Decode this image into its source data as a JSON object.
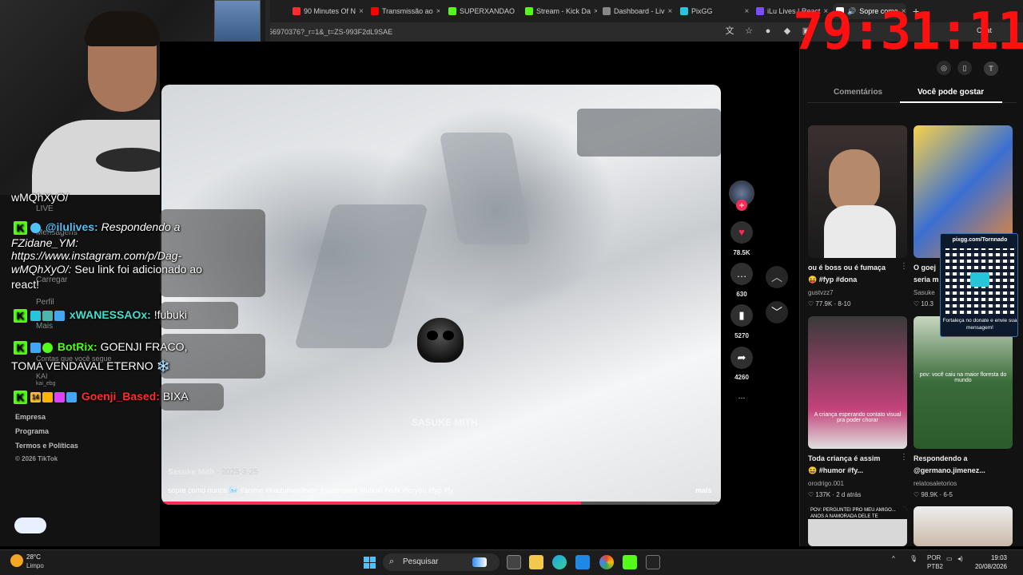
{
  "browser": {
    "tabs": [
      {
        "label": "90 Minutes Of N",
        "color": "#ff2d2d"
      },
      {
        "label": "Transmissão ao",
        "color": "#ff0000"
      },
      {
        "label": "SUPERXANDAO",
        "color": "#53fc18"
      },
      {
        "label": "Stream - Kick Da",
        "color": "#53fc18"
      },
      {
        "label": "Dashboard - Liv",
        "color": "#888888"
      },
      {
        "label": "PixGG",
        "color": "#26c6da"
      },
      {
        "label": "iLu Lives | React",
        "color": "#7c4dff"
      },
      {
        "label": "Sopre como",
        "color": "#ffffff"
      }
    ],
    "url": "56970376?_r=1&_t=ZS-993F2dL9SAE",
    "chat_label": "Chat"
  },
  "timer": "79:31:11",
  "sidebar": {
    "items": [
      "LIVE",
      "Mensagens",
      "Carregar",
      "Perfil",
      "Mais"
    ],
    "following_label": "Contas que você segue",
    "following_user": "KAI",
    "following_handle": "kai_ebg",
    "footer": [
      "Empresa",
      "Programa",
      "Termos e Políticas"
    ],
    "copyright": "© 2026 TikTok"
  },
  "video": {
    "author": "Sasuke Mith",
    "date": "· 2025-3-25",
    "caption": "sopre como nunca 🌬️ #anime #inazumaeleven #superonze #fubuki #edit #foryou #fyp #fy",
    "more": "mais",
    "watermark": "SASUKE MITH",
    "progress": 0.75
  },
  "actions": {
    "likes": "78.5K",
    "comments": "630",
    "saves": "5270",
    "shares": "4260"
  },
  "right_panel": {
    "tabs": [
      "Comentários",
      "Você pode gostar"
    ],
    "cards": [
      {
        "title": "ou é boss ou é fumaça",
        "sub": "😝 #fyp #dona",
        "author": "gustvzz7",
        "stats": "♡ 77.9K · 8-10"
      },
      {
        "title": "O goej",
        "sub": "seria m",
        "author": "Sasuke",
        "stats": "♡ 10.3"
      },
      {
        "title": "Toda criança é assim",
        "sub": "😆 #humor #fy...",
        "author": "orodrigo.001",
        "stats": "♡ 137K · 2 d atrás",
        "overlay": "A criança esperando contato visual pra poder chorar"
      },
      {
        "title": "Respondendo a",
        "sub": "@germano.jimenez...",
        "author": "relatosaletorios",
        "stats": "♡ 98.9K · 6-5",
        "overlay": "pov: você caiu na maior floresta do mundo"
      }
    ],
    "bottom_overlay": "POV: PERGUNTEI PRO MEU AMIGO... ANOS A NAMORADA DELE TE"
  },
  "pix": {
    "title": "pixgg.com/Tornnado",
    "text": "Fortaleça no donate e envie sua mensagem!"
  },
  "chat": {
    "line0": "wMQhXyO/",
    "m1_user": "@ilulives:",
    "m1_text": "Respondendo a",
    "m1_l2": "FZidane_YM:",
    "m1_l3": "https://www.instagram.com/p/Dag-",
    "m1_l4": "wMQhXyO/:",
    "m1_l4b": "Seu link foi adicionado ao",
    "m1_l5": "react!",
    "m2_user": "xWANESSAOx:",
    "m2_text": "!fubuki",
    "m3_user": "BotRix:",
    "m3_text": "GOENJI FRACO,",
    "m3_l2": "TOMA VENDAVAL ETERNO ❄️",
    "m4_badge": "14",
    "m4_user": "Goenji_Based:",
    "m4_text": "BIXA"
  },
  "taskbar": {
    "temp": "28°C",
    "weather": "Limpo",
    "search": "Pesquisar",
    "lang": "POR",
    "kb": "PTB2",
    "time": "19:03",
    "date": "20/08/2026"
  }
}
